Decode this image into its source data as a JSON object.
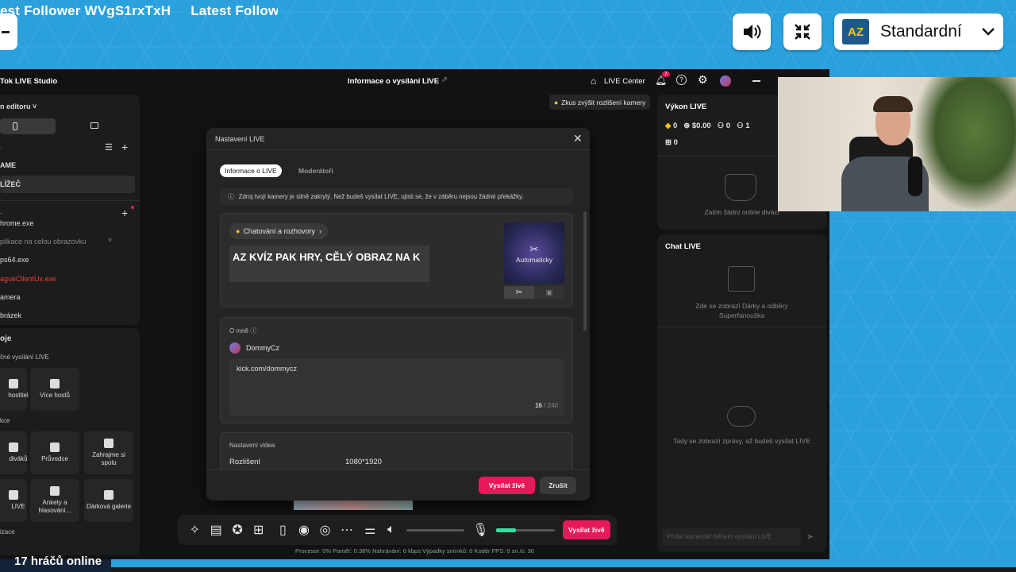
{
  "overlay": {
    "ticker": [
      "est Follower WVgS1rxTxH",
      "Latest Followe"
    ],
    "language": {
      "logo": "AZ",
      "label": "Standardní"
    },
    "bottom_ticker": "17 hráčů online"
  },
  "app": {
    "title": "Tok LIVE Studio",
    "center_title": "Informace o vysílání LIVE",
    "live_center": "LIVE Center",
    "notif_count": "7",
    "camera_tip": "Zkus zvýšit rozlišení kamery"
  },
  "left": {
    "scene_title": "n editoru",
    "items": [
      "AME",
      "LÍŽEČ"
    ],
    "sources": [
      "hrome.exe",
      "plikace na celou obrazovku",
      "ps64.exe",
      "agueClientUx.exe",
      "amera",
      "brázek"
    ],
    "tools_title": "oje",
    "section_live": "čné vysílání LIVE",
    "tile_host": "hostitel",
    "tile_more_hosts": "Více hostů",
    "section_inter": "kce",
    "tiles": [
      "diváků",
      "Průvodce",
      "Zahrajme si spolu",
      "LIVE",
      "Ankety a hlasování...",
      "Dárková galerie"
    ],
    "section_org": "izace"
  },
  "modal": {
    "title": "Nastavení LIVE",
    "tab_info": "Informace o LIVE",
    "tab_mods": "Moderátoři",
    "warning": "Zdroj tvojí kamery je silně zakrytý. Než budeš vysílat LIVE, ujisti se, že v záběru nejsou žádné překážky.",
    "category": "Chatování a rozhovory",
    "stream_title": "AZ KVÍZ PAK HRY, CĚLÝ OBRAZ NA K",
    "thumb_label": "Automaticky",
    "about_label": "O mně",
    "username": "DommyCz",
    "bio": "kick.com/dommycz",
    "char_count": "16",
    "char_max": "/ 240",
    "video_settings": "Nastavení videa",
    "resolution_label": "Rozlišení",
    "resolution_value": "1080*1920",
    "go_live": "Vysílat živě",
    "cancel": "Zrušit"
  },
  "right": {
    "perf_title": "Výkon LIVE",
    "stats": [
      "0",
      "$0.00",
      "0",
      "1",
      "0"
    ],
    "no_viewers": "Zatím žádní online diváci",
    "chat_title": "Chat LIVE",
    "gifts_text": "Zde se zobrazí Dárky a odběry Superfanouška",
    "messages_text": "Tady se zobrazí zprávy, až budeš vysílat LIVE",
    "comment_placeholder": "Přidat komentář během vysílání LIVE"
  },
  "toolbar": {
    "go_live": "Vysílat živě"
  },
  "statusbar": "Procesor: 0%     Paměť: 0.38%     Nahrávání: 0 kbps     Výpadky snímků: 0     Kodér FPS: 0     sn./s: 30",
  "colors": {
    "accent": "#e8195a",
    "bg_blue": "#2aa0dc",
    "panel": "#1c1c1c"
  }
}
